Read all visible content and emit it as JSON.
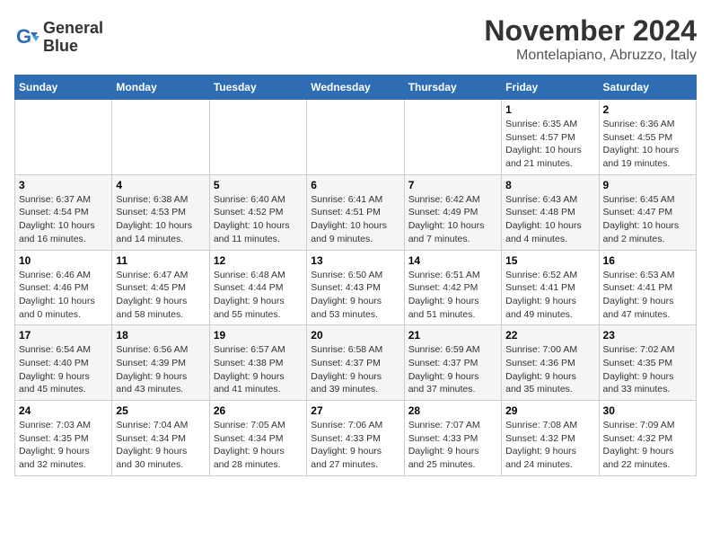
{
  "header": {
    "logo_line1": "General",
    "logo_line2": "Blue",
    "title": "November 2024",
    "subtitle": "Montelapiano, Abruzzo, Italy"
  },
  "weekdays": [
    "Sunday",
    "Monday",
    "Tuesday",
    "Wednesday",
    "Thursday",
    "Friday",
    "Saturday"
  ],
  "weeks": [
    [
      {
        "day": "",
        "info": ""
      },
      {
        "day": "",
        "info": ""
      },
      {
        "day": "",
        "info": ""
      },
      {
        "day": "",
        "info": ""
      },
      {
        "day": "",
        "info": ""
      },
      {
        "day": "1",
        "info": "Sunrise: 6:35 AM\nSunset: 4:57 PM\nDaylight: 10 hours\nand 21 minutes."
      },
      {
        "day": "2",
        "info": "Sunrise: 6:36 AM\nSunset: 4:55 PM\nDaylight: 10 hours\nand 19 minutes."
      }
    ],
    [
      {
        "day": "3",
        "info": "Sunrise: 6:37 AM\nSunset: 4:54 PM\nDaylight: 10 hours\nand 16 minutes."
      },
      {
        "day": "4",
        "info": "Sunrise: 6:38 AM\nSunset: 4:53 PM\nDaylight: 10 hours\nand 14 minutes."
      },
      {
        "day": "5",
        "info": "Sunrise: 6:40 AM\nSunset: 4:52 PM\nDaylight: 10 hours\nand 11 minutes."
      },
      {
        "day": "6",
        "info": "Sunrise: 6:41 AM\nSunset: 4:51 PM\nDaylight: 10 hours\nand 9 minutes."
      },
      {
        "day": "7",
        "info": "Sunrise: 6:42 AM\nSunset: 4:49 PM\nDaylight: 10 hours\nand 7 minutes."
      },
      {
        "day": "8",
        "info": "Sunrise: 6:43 AM\nSunset: 4:48 PM\nDaylight: 10 hours\nand 4 minutes."
      },
      {
        "day": "9",
        "info": "Sunrise: 6:45 AM\nSunset: 4:47 PM\nDaylight: 10 hours\nand 2 minutes."
      }
    ],
    [
      {
        "day": "10",
        "info": "Sunrise: 6:46 AM\nSunset: 4:46 PM\nDaylight: 10 hours\nand 0 minutes."
      },
      {
        "day": "11",
        "info": "Sunrise: 6:47 AM\nSunset: 4:45 PM\nDaylight: 9 hours\nand 58 minutes."
      },
      {
        "day": "12",
        "info": "Sunrise: 6:48 AM\nSunset: 4:44 PM\nDaylight: 9 hours\nand 55 minutes."
      },
      {
        "day": "13",
        "info": "Sunrise: 6:50 AM\nSunset: 4:43 PM\nDaylight: 9 hours\nand 53 minutes."
      },
      {
        "day": "14",
        "info": "Sunrise: 6:51 AM\nSunset: 4:42 PM\nDaylight: 9 hours\nand 51 minutes."
      },
      {
        "day": "15",
        "info": "Sunrise: 6:52 AM\nSunset: 4:41 PM\nDaylight: 9 hours\nand 49 minutes."
      },
      {
        "day": "16",
        "info": "Sunrise: 6:53 AM\nSunset: 4:41 PM\nDaylight: 9 hours\nand 47 minutes."
      }
    ],
    [
      {
        "day": "17",
        "info": "Sunrise: 6:54 AM\nSunset: 4:40 PM\nDaylight: 9 hours\nand 45 minutes."
      },
      {
        "day": "18",
        "info": "Sunrise: 6:56 AM\nSunset: 4:39 PM\nDaylight: 9 hours\nand 43 minutes."
      },
      {
        "day": "19",
        "info": "Sunrise: 6:57 AM\nSunset: 4:38 PM\nDaylight: 9 hours\nand 41 minutes."
      },
      {
        "day": "20",
        "info": "Sunrise: 6:58 AM\nSunset: 4:37 PM\nDaylight: 9 hours\nand 39 minutes."
      },
      {
        "day": "21",
        "info": "Sunrise: 6:59 AM\nSunset: 4:37 PM\nDaylight: 9 hours\nand 37 minutes."
      },
      {
        "day": "22",
        "info": "Sunrise: 7:00 AM\nSunset: 4:36 PM\nDaylight: 9 hours\nand 35 minutes."
      },
      {
        "day": "23",
        "info": "Sunrise: 7:02 AM\nSunset: 4:35 PM\nDaylight: 9 hours\nand 33 minutes."
      }
    ],
    [
      {
        "day": "24",
        "info": "Sunrise: 7:03 AM\nSunset: 4:35 PM\nDaylight: 9 hours\nand 32 minutes."
      },
      {
        "day": "25",
        "info": "Sunrise: 7:04 AM\nSunset: 4:34 PM\nDaylight: 9 hours\nand 30 minutes."
      },
      {
        "day": "26",
        "info": "Sunrise: 7:05 AM\nSunset: 4:34 PM\nDaylight: 9 hours\nand 28 minutes."
      },
      {
        "day": "27",
        "info": "Sunrise: 7:06 AM\nSunset: 4:33 PM\nDaylight: 9 hours\nand 27 minutes."
      },
      {
        "day": "28",
        "info": "Sunrise: 7:07 AM\nSunset: 4:33 PM\nDaylight: 9 hours\nand 25 minutes."
      },
      {
        "day": "29",
        "info": "Sunrise: 7:08 AM\nSunset: 4:32 PM\nDaylight: 9 hours\nand 24 minutes."
      },
      {
        "day": "30",
        "info": "Sunrise: 7:09 AM\nSunset: 4:32 PM\nDaylight: 9 hours\nand 22 minutes."
      }
    ]
  ]
}
